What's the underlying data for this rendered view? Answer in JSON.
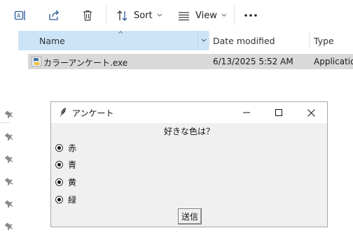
{
  "toolbar": {
    "sort_label": "Sort",
    "view_label": "View",
    "icons": [
      "rename-icon",
      "share-icon",
      "delete-icon",
      "sort-icon",
      "view-icon",
      "more-icon"
    ]
  },
  "columns": {
    "name": "Name",
    "date_modified": "Date modified",
    "type": "Type"
  },
  "files": [
    {
      "name": "カラーアンケート.exe",
      "date_modified": "6/13/2025 5:52 AM",
      "type": "Application"
    }
  ],
  "dialog": {
    "title": "アンケート",
    "question": "好きな色は？",
    "options": [
      "赤",
      "青",
      "黄",
      "緑"
    ],
    "submit_label": "送信"
  },
  "colors": {
    "header_selected": "#cce4f7",
    "row_selected": "#d9d9d9",
    "dialog_bg": "#f0f0f0"
  }
}
